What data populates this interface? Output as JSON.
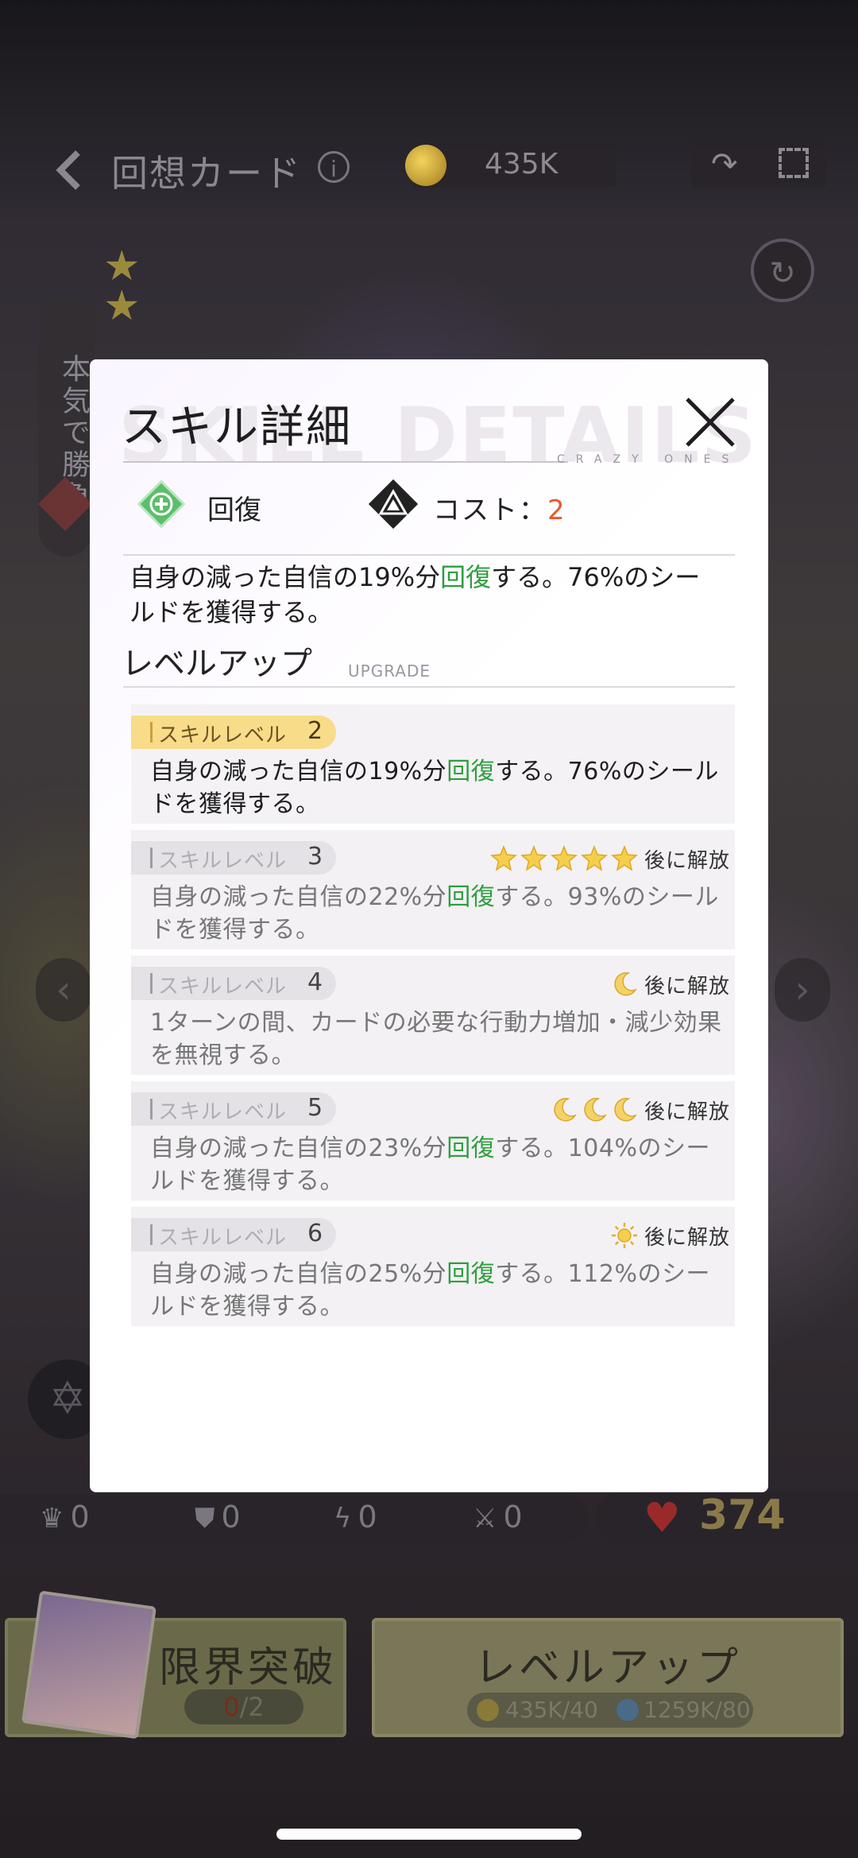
{
  "header": {
    "title": "回想カード",
    "coins": "435K"
  },
  "side_tab_label": "本気で勝負",
  "stats": {
    "crown": "0",
    "shield": "0",
    "lightning": "0",
    "swords": "0",
    "hp": "374"
  },
  "bottom": {
    "limit_break_label": "限界突破",
    "limit_break_current": "0",
    "limit_break_total": "/2",
    "level_up_label": "レベルアップ",
    "level_up_coin_cost": "435K/40",
    "level_up_exp_cost": "1259K/80"
  },
  "modal": {
    "title": "スキル詳細",
    "watermark": "SKILL DETAILS",
    "brand": "CRAZY ONES",
    "type_label": "回復",
    "cost_label": "コスト：",
    "cost_value": "2",
    "description": {
      "pre": "自身の減った自信の19%分",
      "heal": "回復",
      "post": "する。76%のシールドを獲得する。"
    },
    "upgrade_title": "レベルアップ",
    "upgrade_sub": "UPGRADE",
    "level_prefix": "スキルレベル",
    "unlock_text": "後に解放",
    "levels": [
      {
        "num": "2",
        "pre": "自身の減った自信の19%分",
        "heal": "回復",
        "post": "する。76%のシールドを獲得する。"
      },
      {
        "num": "3",
        "pre": "自身の減った自信の22%分",
        "heal": "回復",
        "post": "する。93%のシールドを獲得する。",
        "requirement": "star",
        "req_count": 5
      },
      {
        "num": "4",
        "pre": "1ターンの間、カードの必要な行動力増加・減少効果を無視する。",
        "heal": "",
        "post": "",
        "requirement": "moon",
        "req_count": 1
      },
      {
        "num": "5",
        "pre": "自身の減った自信の23%分",
        "heal": "回復",
        "post": "する。104%のシールドを獲得する。",
        "requirement": "moon",
        "req_count": 3
      },
      {
        "num": "6",
        "pre": "自身の減った自信の25%分",
        "heal": "回復",
        "post": "する。112%のシールドを獲得する。",
        "requirement": "sun",
        "req_count": 1
      }
    ]
  },
  "colors": {
    "heal_green": "#2e9e3e",
    "cost_orange": "#e85a2a",
    "current_level_pill": "#f8dc8a",
    "hp_red": "#9a2a2a"
  }
}
